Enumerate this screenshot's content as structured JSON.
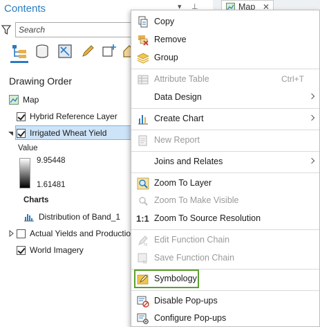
{
  "contents_pane": {
    "title": "Contents",
    "title_controls": [
      "▾",
      "⊥"
    ],
    "search_placeholder": "Search",
    "section_title": "Drawing Order",
    "tree": {
      "map_label": "Map",
      "layers": [
        {
          "label": "Hybrid Reference Layer",
          "checked": true
        },
        {
          "label": "Irrigated Wheat Yield",
          "checked": true,
          "selected": true
        },
        {
          "label": "Actual Yields and Productio",
          "checked": false
        },
        {
          "label": "World Imagery",
          "checked": true
        }
      ],
      "legend": {
        "value_label": "Value",
        "max": "9.95448",
        "min": "1.61481",
        "charts_label": "Charts",
        "chart_item": "Distribution of Band_1"
      }
    }
  },
  "map_tab": {
    "label": "Map",
    "close_glyph": "✕"
  },
  "context_menu": {
    "items": [
      {
        "label": "Copy",
        "icon": "copy-icon",
        "enabled": true
      },
      {
        "label": "Remove",
        "icon": "remove-icon",
        "enabled": true
      },
      {
        "label": "Group",
        "icon": "group-icon",
        "enabled": true
      },
      {
        "label": "Attribute Table",
        "icon": "attribute-table-icon",
        "enabled": false,
        "shortcut": "Ctrl+T"
      },
      {
        "label": "Data Design",
        "enabled": true,
        "submenu": true
      },
      {
        "label": "Create Chart",
        "icon": "create-chart-icon",
        "enabled": true,
        "submenu": true
      },
      {
        "label": "New Report",
        "icon": "new-report-icon",
        "enabled": false
      },
      {
        "label": "Joins and Relates",
        "enabled": true,
        "submenu": true
      },
      {
        "label": "Zoom To Layer",
        "icon": "zoom-to-layer-icon",
        "enabled": true
      },
      {
        "label": "Zoom To Make Visible",
        "icon": "zoom-to-make-visible-icon",
        "enabled": false
      },
      {
        "label": "Zoom To Source Resolution",
        "icon": "source-resolution-icon",
        "icon_text": "1:1",
        "enabled": true
      },
      {
        "label": "Edit Function Chain",
        "icon": "edit-function-chain-icon",
        "enabled": false
      },
      {
        "label": "Save Function Chain",
        "icon": "save-function-chain-icon",
        "enabled": false
      },
      {
        "label": "Symbology",
        "icon": "symbology-icon",
        "enabled": true,
        "highlighted": true
      },
      {
        "label": "Disable Pop-ups",
        "icon": "disable-popups-icon",
        "enabled": true
      },
      {
        "label": "Configure Pop-ups",
        "icon": "configure-popups-icon",
        "enabled": true
      }
    ]
  },
  "colors": {
    "accent": "#2b7bc1",
    "selection": "#cde3f7",
    "highlight_border": "#5aa02c",
    "disabled_text": "#9a9a9a"
  }
}
